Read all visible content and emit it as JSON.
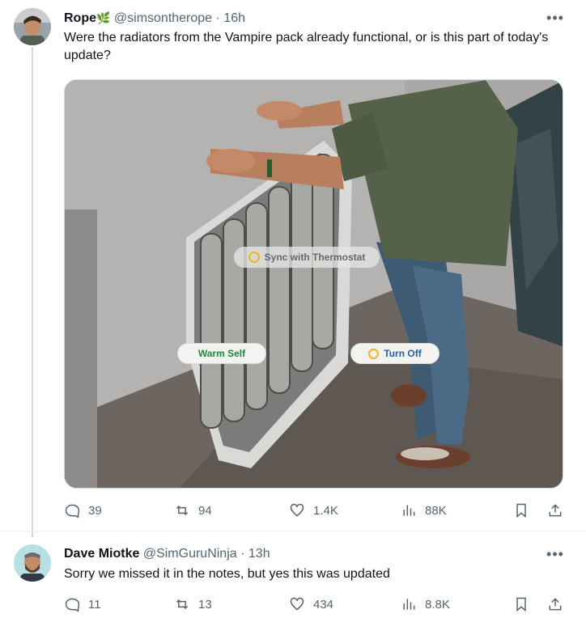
{
  "tweet1": {
    "author_name": "Rope",
    "name_emoji": "🌿",
    "handle": "@simsontherope",
    "separator": "·",
    "time": "16h",
    "text": "Were the radiators from the Vampire pack already functional, or is this part of today's update?",
    "media": {
      "buttons": {
        "sync": "Sync with Thermostat",
        "warm": "Warm Self",
        "turn_off": "Turn Off"
      }
    },
    "stats": {
      "replies": "39",
      "reposts": "94",
      "likes": "1.4K",
      "views": "88K"
    }
  },
  "tweet2": {
    "author_name": "Dave Miotke",
    "handle": "@SimGuruNinja",
    "separator": "·",
    "time": "13h",
    "text": "Sorry we missed it in the notes, but yes this was updated",
    "stats": {
      "replies": "11",
      "reposts": "13",
      "likes": "434",
      "views": "8.8K"
    }
  },
  "icons": [
    "reply-icon",
    "repost-icon",
    "like-icon",
    "views-icon",
    "bookmark-icon",
    "share-icon",
    "more-icon"
  ],
  "colors": {
    "text": "#0f1419",
    "secondary": "#536471",
    "border": "#cfd9de",
    "warm_button_text": "#1e8a3a"
  }
}
